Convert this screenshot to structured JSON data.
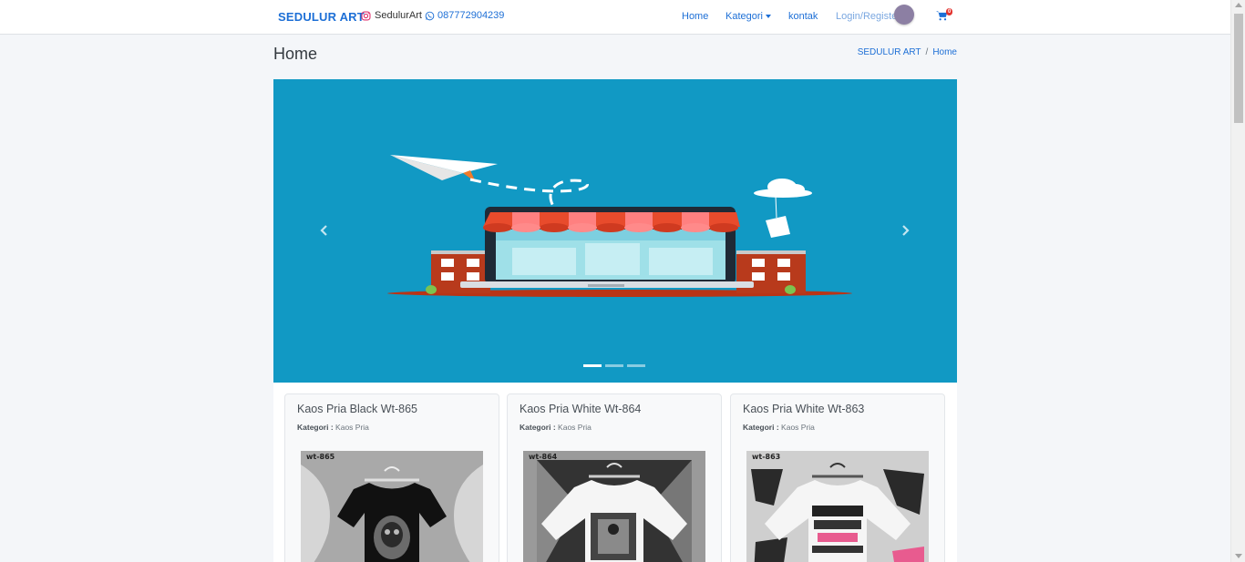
{
  "navbar": {
    "brand": "SEDULUR ART",
    "instagram": "SedulurArt",
    "whatsapp": "087772904239",
    "links": {
      "home": "Home",
      "kategori": "Kategori",
      "kontak": "kontak",
      "login": "Login/Register"
    },
    "cart_count": "0"
  },
  "page": {
    "title": "Home",
    "breadcrumb": [
      "SEDULUR ART",
      "Home"
    ]
  },
  "carousel": {
    "slides": 3,
    "active_index": 0,
    "background": "#1199c4"
  },
  "products": [
    {
      "name": "Kaos Pria Black Wt-865",
      "category_label": "Kategori :",
      "category": "Kaos Pria",
      "code": "wt-865",
      "shirt_color": "#111111"
    },
    {
      "name": "Kaos Pria White Wt-864",
      "category_label": "Kategori :",
      "category": "Kaos Pria",
      "code": "wt-864",
      "shirt_color": "#f5f5f5"
    },
    {
      "name": "Kaos Pria White Wt-863",
      "category_label": "Kategori :",
      "category": "Kaos Pria",
      "code": "wt-863",
      "shirt_color": "#f5f5f5"
    }
  ],
  "colors": {
    "brand_blue": "#1d6fd6",
    "badge_red": "#e3342f"
  }
}
